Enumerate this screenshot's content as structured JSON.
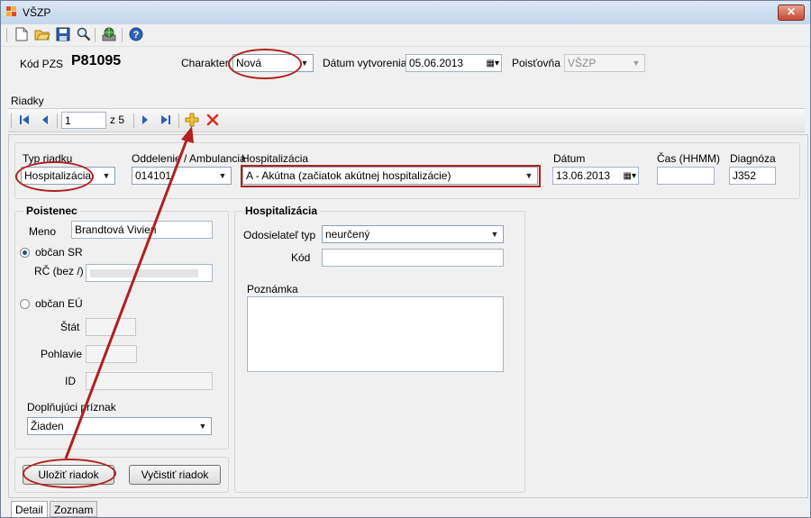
{
  "window": {
    "title": "VŠZP",
    "close_symbol": "✕"
  },
  "toolbar": {
    "icons": [
      "new-icon",
      "open-icon",
      "save-icon",
      "search-icon",
      "globe-icon",
      "help-icon"
    ]
  },
  "header": {
    "pzs_label": "Kód PZS",
    "pzs_value": "P81095",
    "charakter_label": "Charakter",
    "charakter_value": "Nová",
    "datum_vytvorenia_label": "Dátum vytvorenia",
    "datum_vytvorenia_value": "05.06.2013",
    "poistovna_label": "Poisťovňa",
    "poistovna_value": "VŠZP"
  },
  "riadky": {
    "section_label": "Riadky",
    "nav_current": "1",
    "nav_of": "z 5"
  },
  "row_fields": {
    "typ_label": "Typ riadku",
    "typ_value": "Hospitalizácia",
    "oddelenie_label": "Oddelenie / Ambulancia",
    "oddelenie_value": "014101",
    "hospitalizacia_label": "Hospitalizácia",
    "hospitalizacia_value": "A - Akútna (začiatok akútnej hospitalizácie)",
    "datum_label": "Dátum",
    "datum_value": "13.06.2013",
    "cas_label": "Čas (HHMM)",
    "cas_value": "",
    "diagnoza_label": "Diagnóza",
    "diagnoza_value": "J352"
  },
  "poistenec": {
    "title": "Poistenec",
    "meno_label": "Meno",
    "meno_value": "Brandtová Vivien",
    "obcan_sr_label": "občan SR",
    "rc_label": "RČ (bez /)",
    "obcan_eu_label": "občan EÚ",
    "stat_label": "Štát",
    "pohlavie_label": "Pohlavie",
    "id_label": "ID",
    "doplnujuci_label": "Doplňujúci príznak",
    "doplnujuci_value": "Žiaden"
  },
  "hospitalizacia": {
    "title": "Hospitalizácia",
    "odosielatel_label": "Odosielateľ typ",
    "odosielatel_value": "neurčený",
    "kod_label": "Kód",
    "poznamka_label": "Poznámka"
  },
  "buttons": {
    "ulozit": "Uložiť riadok",
    "vycistit": "Vyčistiť riadok"
  },
  "tabs": [
    "Detail",
    "Zoznam"
  ],
  "colors": {
    "annotation_red": "#b22020"
  }
}
